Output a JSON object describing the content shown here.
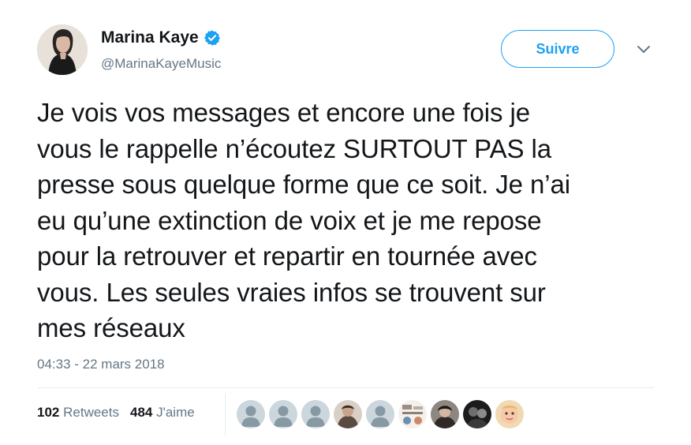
{
  "author": {
    "name": "Marina Kaye",
    "handle": "@MarinaKayeMusic",
    "verified_icon": "verified-badge-icon"
  },
  "actions": {
    "follow_label": "Suivre",
    "more_icon": "chevron-down-icon"
  },
  "tweet": {
    "text": "Je vois vos messages et encore une fois je\nvous le rappelle n’écoutez SURTOUT PAS la\npresse sous quelque forme que ce soit. Je n’ai\neu qu’une extinction de voix et je me repose\npour la retrouver et repartir en tournée avec\nvous. Les seules vraies infos se trouvent sur\nmes réseaux",
    "timestamp": "04:33 - 22 mars 2018"
  },
  "stats": {
    "retweets_count": "102",
    "retweets_label": "Retweets",
    "likes_count": "484",
    "likes_label": "J'aime"
  },
  "liker_avatars": [
    {
      "kind": "default"
    },
    {
      "kind": "default"
    },
    {
      "kind": "default"
    },
    {
      "kind": "photo"
    },
    {
      "kind": "default"
    },
    {
      "kind": "graphic"
    },
    {
      "kind": "photo"
    },
    {
      "kind": "photo-dark"
    },
    {
      "kind": "photo-baby"
    }
  ],
  "colors": {
    "brand": "#1da1f2",
    "text": "#14171a",
    "muted": "#657786",
    "divider": "#e6ecf0"
  }
}
